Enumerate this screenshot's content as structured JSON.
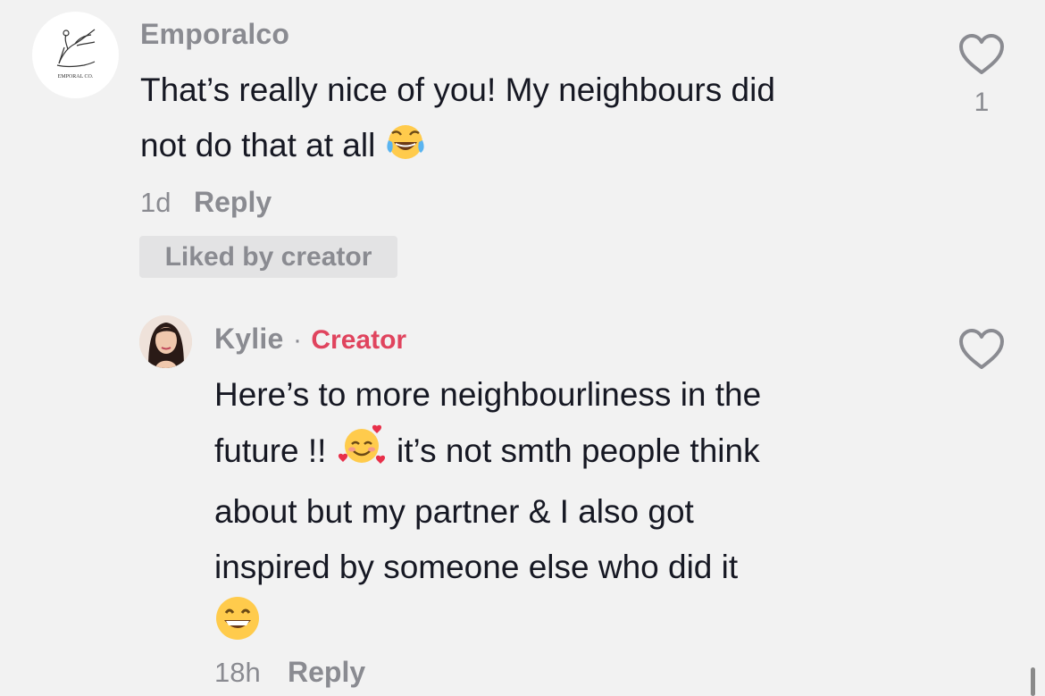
{
  "comments": [
    {
      "username": "Emporalco",
      "avatar_logo_text": "EMPORAL CO.",
      "text_line1": "That’s really nice of you! My neighbours did",
      "text_line2": "not do that at all",
      "emoji": "face-with-tears-of-joy",
      "time": "1d",
      "reply_label": "Reply",
      "liked_badge": "Liked by creator",
      "like_count": "1"
    },
    {
      "username": "Kylie",
      "separator": "·",
      "role_tag": "Creator",
      "text_line1": "Here’s to more neighbourliness in the",
      "text_line2a": "future !!",
      "text_line2b": "it’s not smth people think",
      "text_line3": "about but my partner & I also got",
      "text_line4": "inspired by someone else who did it",
      "emoji_1": "smiling-face-with-hearts",
      "emoji_2": "beaming-face-with-smiling-eyes",
      "time": "18h",
      "reply_label": "Reply"
    }
  ],
  "colors": {
    "background": "#f2f2f2",
    "muted_text": "#8a8b91",
    "creator_accent": "#e0445e",
    "primary_text": "#161823"
  }
}
